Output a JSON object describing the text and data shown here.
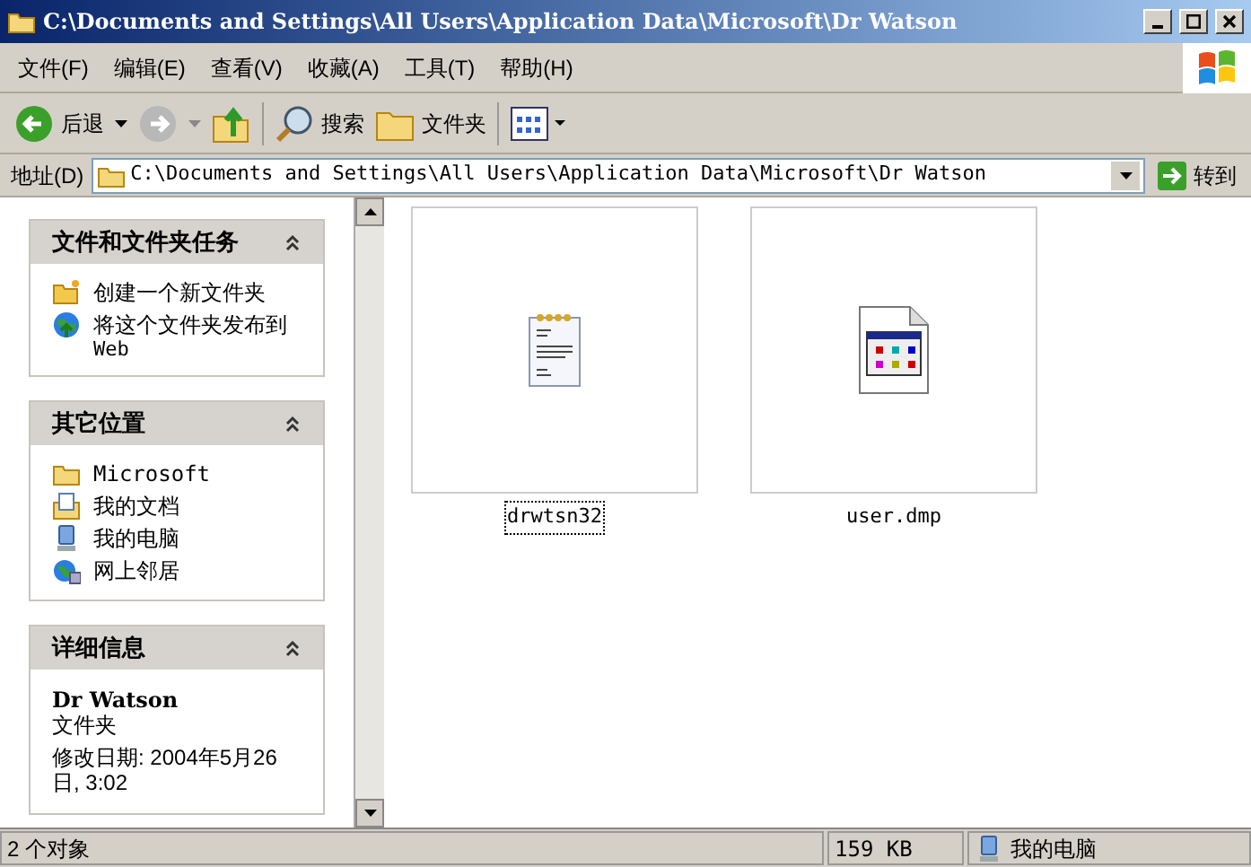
{
  "window": {
    "title": "C:\\Documents and Settings\\All Users\\Application Data\\Microsoft\\Dr Watson"
  },
  "menu": [
    "文件(F)",
    "编辑(E)",
    "查看(V)",
    "收藏(A)",
    "工具(T)",
    "帮助(H)"
  ],
  "toolbar": {
    "back": "后退",
    "search": "搜索",
    "folders": "文件夹"
  },
  "address": {
    "label": "地址(D)",
    "value": "C:\\Documents and Settings\\All Users\\Application Data\\Microsoft\\Dr Watson",
    "go": "转到"
  },
  "panels": [
    {
      "kind": "links",
      "title": "文件和文件夹任务",
      "expanded": true,
      "items": [
        {
          "kind": "new-folder",
          "label": "创建一个新文件夹"
        },
        {
          "kind": "publish",
          "label": "将这个文件夹发布到",
          "label2": "Web"
        }
      ]
    },
    {
      "kind": "links",
      "title": "其它位置",
      "expanded": true,
      "items": [
        {
          "kind": "folder",
          "label": "Microsoft"
        },
        {
          "kind": "documents",
          "label": "我的文档"
        },
        {
          "kind": "computer",
          "label": "我的电脑"
        },
        {
          "kind": "network",
          "label": "网上邻居"
        }
      ]
    },
    {
      "kind": "details",
      "title": "详细信息",
      "expanded": true,
      "name": "Dr Watson",
      "type": "文件夹",
      "modified": "修改日期: 2004年5月26日, 3:02"
    }
  ],
  "files": [
    {
      "kind": "text",
      "name": "drwtsn32",
      "selected": true
    },
    {
      "kind": "dump",
      "name": "user.dmp",
      "selected": false
    }
  ],
  "status_bar": {
    "objects": "2 个对象",
    "size": "159 KB",
    "zone": "我的电脑"
  }
}
